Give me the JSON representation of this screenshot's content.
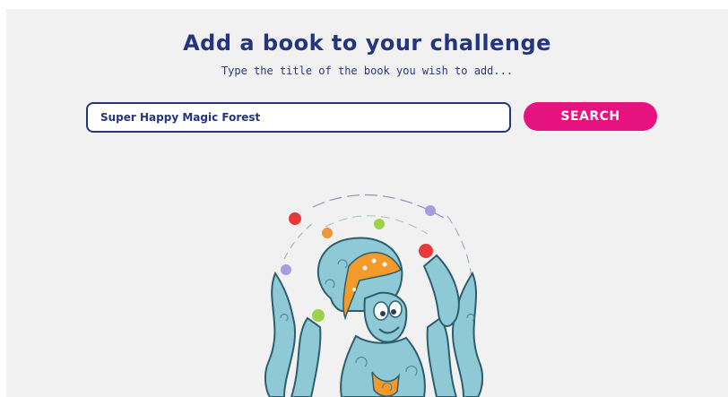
{
  "header": {
    "title": "Add a book to your challenge",
    "subtitle": "Type the title of the book you wish to add..."
  },
  "search": {
    "value": "Super Happy Magic Forest",
    "button_label": "SEARCH"
  },
  "illustration": {
    "icon": "juggling-octopus-illustration",
    "body_color": "#8fc9d6",
    "outline_color": "#2c5f6e",
    "bandana_color": "#f39a2b",
    "ball_colors": [
      "#e63a3a",
      "#f0963a",
      "#9bd34a",
      "#a99be0"
    ]
  }
}
